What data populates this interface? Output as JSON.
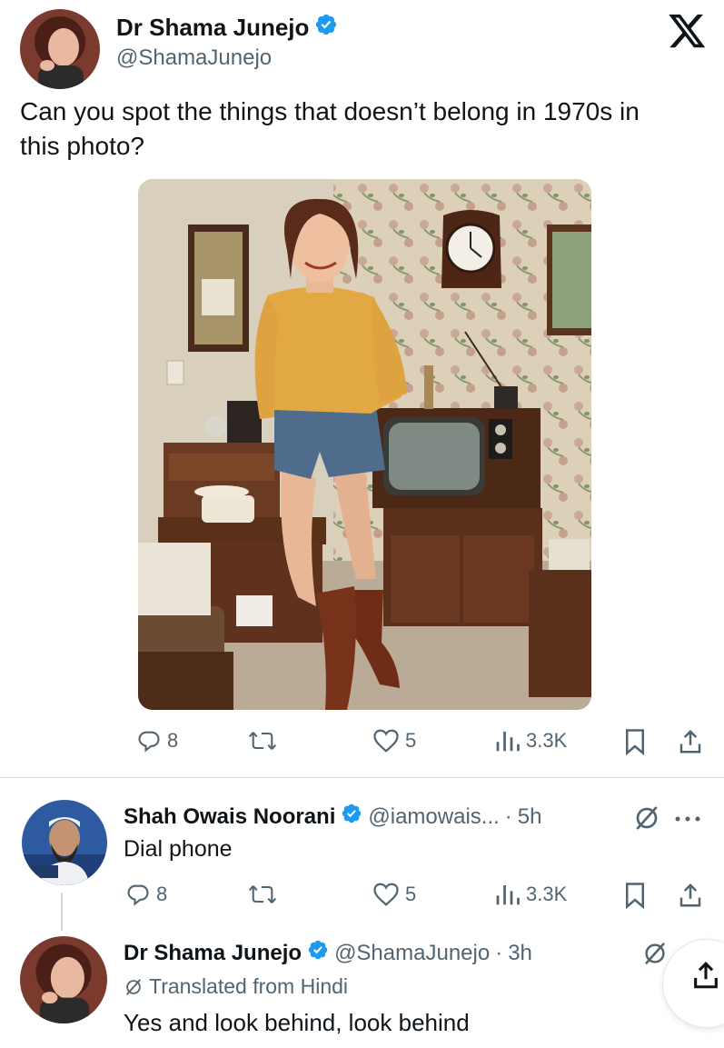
{
  "main_tweet": {
    "author_name": "Dr Shama Junejo",
    "author_handle": "@ShamaJunejo",
    "text": "Can you spot the things that doesn’t belong in 1970s in this photo?",
    "photo_icon": "photo-of-woman-in-1970s-living-room",
    "actions": {
      "replies": "8",
      "reposts": "",
      "likes": "5",
      "views": "3.3K"
    }
  },
  "reply_1": {
    "author_name": "Shah Owais Noorani",
    "author_handle": "@iamowais...",
    "separator": "·",
    "time": "5h",
    "text": "Dial phone",
    "actions": {
      "replies": "8",
      "likes": "5",
      "views": "3.3K"
    }
  },
  "reply_2": {
    "author_name": "Dr Shama Junejo",
    "author_handle": "@ShamaJunejo",
    "separator": "·",
    "time": "3h",
    "translated_label": "Translated from Hindi",
    "text": "Yes and look behind, look behind"
  },
  "colors": {
    "verified": "#1d9bf0",
    "text": "#0f1419",
    "muted": "#536471",
    "divider": "#cfd9de"
  }
}
